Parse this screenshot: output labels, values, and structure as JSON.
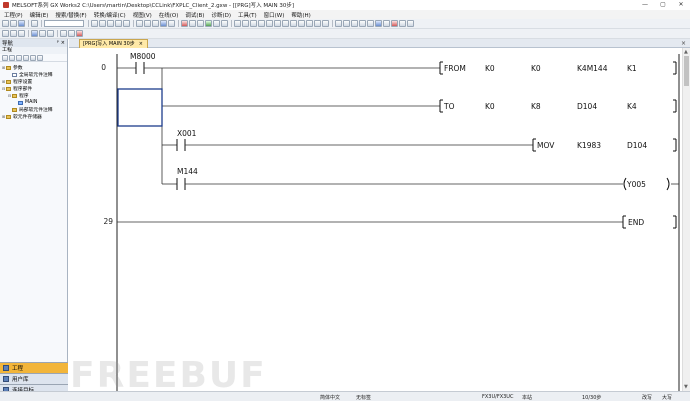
{
  "window": {
    "title": "MELSOFT系列 GX Works2 C:\\Users\\martin\\Desktop\\CCLink\\FXPLC_Client_2.gxw - [[PRG]写入 MAIN 30步]",
    "min_label": "—",
    "max_label": "▢",
    "close_label": "✕"
  },
  "menu": [
    "工程(P)",
    "编辑(E)",
    "搜索/替换(F)",
    "转换/编译(C)",
    "视图(V)",
    "在线(O)",
    "调试(B)",
    "诊断(D)",
    "工具(T)",
    "窗口(W)",
    "帮助(H)"
  ],
  "nav": {
    "header": "导航",
    "pin": "ᵖ",
    "close": "×",
    "sub": "工程",
    "tree": [
      {
        "label": "参数",
        "exp": "⊞",
        "indent": 0,
        "icon": "folder"
      },
      {
        "label": "全局软元件注释",
        "exp": "",
        "indent": 1,
        "icon": "doc"
      },
      {
        "label": "程序设置",
        "exp": "⊞",
        "indent": 0,
        "icon": "folder"
      },
      {
        "label": "程序部件",
        "exp": "⊟",
        "indent": 0,
        "icon": "folder"
      },
      {
        "label": "程序",
        "exp": "⊟",
        "indent": 1,
        "icon": "folder"
      },
      {
        "label": "MAIN",
        "exp": "",
        "indent": 2,
        "icon": "prog"
      },
      {
        "label": "局部软元件注释",
        "exp": "",
        "indent": 1,
        "icon": "folder"
      },
      {
        "label": "软元件存储器",
        "exp": "⊞",
        "indent": 0,
        "icon": "folder"
      }
    ],
    "tabs": [
      {
        "label": "工程",
        "active": true
      },
      {
        "label": "用户库",
        "active": false
      },
      {
        "label": "连接目标",
        "active": false
      }
    ]
  },
  "editor_tab": {
    "label": "[PRG]写入 MAIN 30步",
    "close": "×",
    "window_close": "×"
  },
  "ladder": {
    "rungs": [
      {
        "step": "0"
      },
      {
        "step": "29"
      }
    ],
    "contacts": [
      {
        "device": "M8000"
      },
      {
        "device": "X001"
      },
      {
        "device": "M144"
      }
    ],
    "instructions": [
      {
        "op": "FROM",
        "args": [
          "K0",
          "K0",
          "K4M144",
          "K1"
        ]
      },
      {
        "op": "TO",
        "args": [
          "K0",
          "K8",
          "D104",
          "K4"
        ]
      },
      {
        "op": "MOV",
        "args": [
          "K1983",
          "D104"
        ]
      }
    ],
    "coil": "Y005",
    "end": "END"
  },
  "status": {
    "language": "简体中文",
    "label_status": "无标签",
    "cpu": "FX3U/FX3UC",
    "station": "本站",
    "steps": "10/30步",
    "mode": "改写",
    "caps": "大写"
  },
  "watermark": "FREEBUF",
  "colors": {
    "cursor": "#1c3c8c",
    "active_tab": "#ffe9a8",
    "nav_active": "#f2b53a"
  }
}
